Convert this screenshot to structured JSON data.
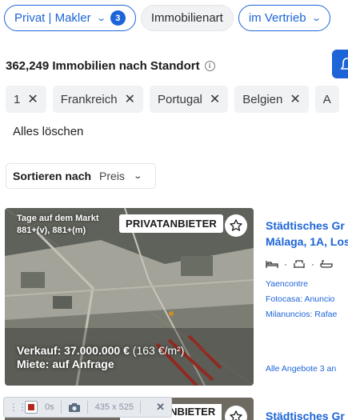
{
  "filters": [
    {
      "label": "Privat | Makler",
      "count": "3"
    },
    {
      "label": "Immobilienart"
    },
    {
      "label": "im Vertrieb"
    }
  ],
  "results": {
    "title": "362,249 Immobilien nach Standort",
    "info_icon": "info-icon",
    "alert_icon": "bell-icon"
  },
  "chips": [
    {
      "label": "1"
    },
    {
      "label": "Frankreich"
    },
    {
      "label": "Portugal"
    },
    {
      "label": "Belgien"
    },
    {
      "label": "A"
    }
  ],
  "clear_all": "Alles löschen",
  "sort": {
    "label": "Sortieren nach",
    "value": "Preis"
  },
  "listing": {
    "days_on_market_label": "Tage auf dem Markt",
    "days_on_market_value": "881+(v), 881+(m)",
    "badge": "PRIVATANBIETER",
    "price_sale_prefix": "Verkauf: 37.000.000 €",
    "price_sale_sqm": "(163 €/m²)",
    "price_rent": "Miete: auf Anfrage",
    "title_line1": "Städtisches Gr",
    "title_line2": "Málaga, 1A, Los",
    "amenity_icons": [
      "bed-icon",
      "sofa-icon",
      "bath-icon"
    ],
    "agencies": [
      "Yaencontre",
      "Fotocasa: Anuncio",
      "Milanuncios: Rafae"
    ],
    "all_offers": "Alle Angebote 3 an"
  },
  "listing2": {
    "badge": "PRIVATANBIETER",
    "title": "Städtisches Gr"
  },
  "recorder": {
    "time": "0s",
    "size": "435 x 525"
  },
  "colors": {
    "accent": "#1c64d8",
    "chip_bg": "#f1f2f4"
  }
}
